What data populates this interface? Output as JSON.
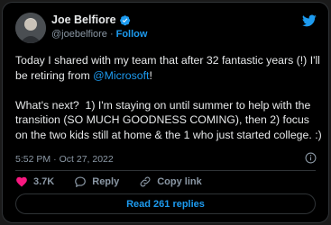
{
  "author": {
    "name": "Joe Belfiore",
    "handle": "@joebelfiore",
    "separator": "·",
    "follow_label": "Follow"
  },
  "tweet": {
    "line1": "Today I shared with my team that after 32 fantastic years (!) I'll be retiring from ",
    "mention": "@Microsoft",
    "line1_end": "!",
    "para2": "What's next?  1) I'm staying on until summer to help with the transition (SO MUCH GOODNESS COMING), then 2) focus on the two kids still at home & the 1 who just started college. :)"
  },
  "meta": {
    "time": "5:52 PM",
    "separator": "·",
    "date": "Oct 27, 2022"
  },
  "actions": {
    "likes": "3.7K",
    "reply_label": "Reply",
    "copy_label": "Copy link"
  },
  "read_replies_label": "Read 261 replies",
  "colors": {
    "accent": "#1d9bf0",
    "like": "#f91880",
    "background": "#000000",
    "muted_text": "#8b98a5"
  },
  "icons": [
    "twitter-bird-icon",
    "verified-badge-icon",
    "info-icon",
    "heart-icon",
    "reply-icon",
    "link-icon"
  ]
}
